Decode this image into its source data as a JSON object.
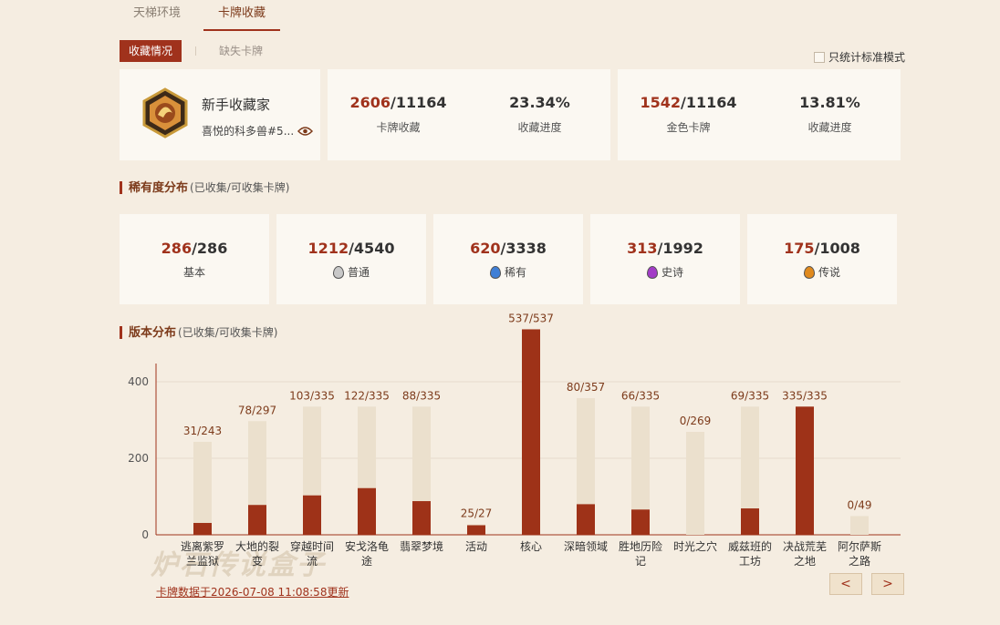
{
  "top_tabs": [
    {
      "label": "天梯环境"
    },
    {
      "label": "卡牌收藏"
    }
  ],
  "sub_tabs": [
    {
      "label": "收藏情况"
    },
    {
      "label": "缺失卡牌"
    }
  ],
  "standard_only_label": "只统计标准模式",
  "profile": {
    "title": "新手收藏家",
    "name": "喜悦的科多兽#5..."
  },
  "collection": {
    "cards_owned": "2606",
    "cards_total": "/11164",
    "cards_label": "卡牌收藏",
    "progress": "23.34%",
    "progress_label": "收藏进度",
    "gold_owned": "1542",
    "gold_total": "/11164",
    "gold_label": "金色卡牌",
    "gold_progress": "13.81%",
    "gold_progress_label": "收藏进度"
  },
  "rarity_section": {
    "title": "稀有度分布",
    "note": "(已收集/可收集卡牌)"
  },
  "rarity": [
    {
      "owned": "286",
      "total": "/286",
      "label": "基本",
      "gem": ""
    },
    {
      "owned": "1212",
      "total": "/4540",
      "label": "普通",
      "gem": "#c8c8c8"
    },
    {
      "owned": "620",
      "total": "/3338",
      "label": "稀有",
      "gem": "#3f7fd6"
    },
    {
      "owned": "313",
      "total": "/1992",
      "label": "史诗",
      "gem": "#a23cc7"
    },
    {
      "owned": "175",
      "total": "/1008",
      "label": "传说",
      "gem": "#e08a1e"
    }
  ],
  "version_section": {
    "title": "版本分布",
    "note": "(已收集/可收集卡牌)"
  },
  "chart_data": {
    "type": "bar",
    "ylim": [
      0,
      450
    ],
    "yticks": [
      0,
      200,
      400
    ],
    "categories": [
      [
        "逃离紫罗",
        "兰监狱"
      ],
      [
        "大地的裂",
        "变"
      ],
      [
        "穿越时间",
        "流"
      ],
      [
        "安戈洛龟",
        "途"
      ],
      [
        "翡翠梦境"
      ],
      [
        "活动"
      ],
      [
        "核心"
      ],
      [
        "深暗领域"
      ],
      [
        "胜地历险",
        "记"
      ],
      [
        "时光之穴"
      ],
      [
        "威兹班的",
        "工坊"
      ],
      [
        "决战荒芜",
        "之地"
      ],
      [
        "阿尔萨斯",
        "之路"
      ]
    ],
    "series": [
      {
        "name": "已收集",
        "values": [
          31,
          78,
          103,
          122,
          88,
          25,
          537,
          80,
          66,
          0,
          69,
          335,
          0
        ]
      },
      {
        "name": "可收集卡牌",
        "values": [
          243,
          297,
          335,
          335,
          335,
          27,
          537,
          357,
          335,
          269,
          335,
          335,
          49
        ]
      }
    ],
    "value_labels": [
      "31/243",
      "78/297",
      "103/335",
      "122/335",
      "88/335",
      "25/27",
      "537/537",
      "80/357",
      "66/335",
      "0/269",
      "69/335",
      "335/335",
      "0/49"
    ],
    "colors": {
      "owned": "#9e3218",
      "total": "#ebe0cd",
      "axis": "#a0321c",
      "grid": "#e6dccd"
    }
  },
  "nav": {
    "prev": "<",
    "next": ">"
  },
  "footer": "卡牌数据于2026-07-08 11:08:58更新",
  "watermark": "炉石传说盒子"
}
